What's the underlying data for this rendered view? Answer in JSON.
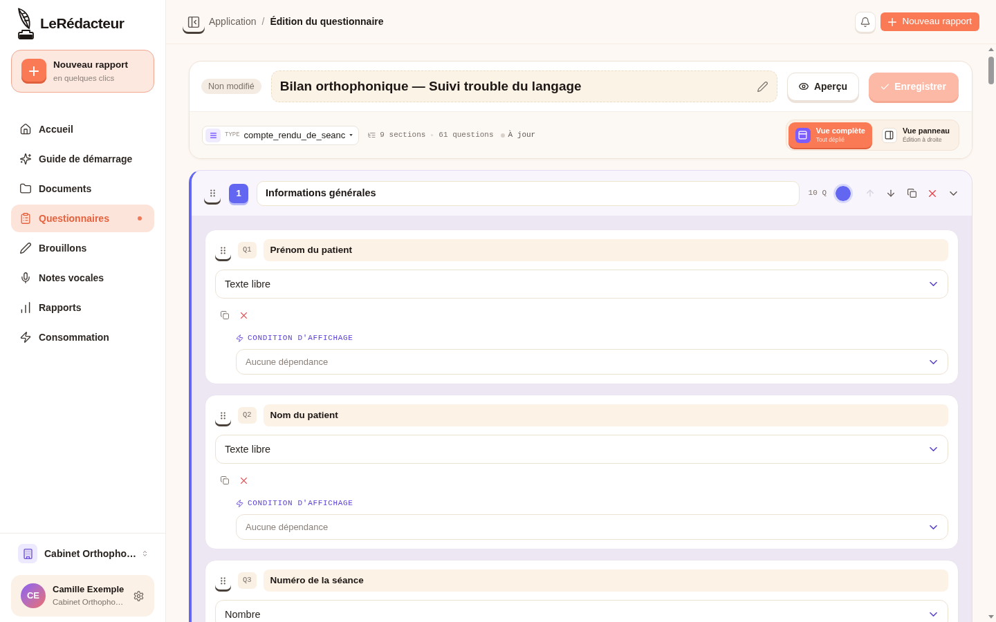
{
  "sidebar": {
    "brand": "LeRédacteur",
    "new_report": {
      "title": "Nouveau rapport",
      "subtitle": "en quelques clics"
    },
    "nav": [
      {
        "label": "Accueil",
        "selected": false
      },
      {
        "label": "Guide de démarrage",
        "selected": false
      },
      {
        "label": "Documents",
        "selected": false
      },
      {
        "label": "Questionnaires",
        "selected": true
      },
      {
        "label": "Brouillons",
        "selected": false
      },
      {
        "label": "Notes vocales",
        "selected": false
      },
      {
        "label": "Rapports",
        "selected": false
      },
      {
        "label": "Consommation",
        "selected": false
      }
    ],
    "workspace": {
      "name": "Cabinet Orthopho…"
    },
    "user": {
      "initials": "CE",
      "name": "Camille Exemple",
      "organization": "Cabinet Orthopho…"
    }
  },
  "header": {
    "breadcrumb": [
      "Application",
      "Édition du questionnaire"
    ],
    "separator": "/",
    "new_report_button": "Nouveau rapport"
  },
  "editor": {
    "status": "Non modifié",
    "title": "Bilan orthophonique — Suivi trouble du langage",
    "preview_button": "Aperçu",
    "save_button": {
      "label": "Enregistrer",
      "disabled": true
    },
    "type": {
      "label": "TYPE",
      "value": "compte_rendu_de_seanc"
    },
    "stats": [
      "9 sections",
      "61 questions"
    ],
    "sync_status": "À jour",
    "views": [
      {
        "title": "Vue complète",
        "subtitle": "Tout déplié",
        "selected": true
      },
      {
        "title": "Vue panneau",
        "subtitle": "Édition à droite",
        "selected": false
      }
    ]
  },
  "sections": [
    {
      "number": "1",
      "title": "Informations générales",
      "count": "10 Q",
      "color": "#6366f1",
      "actions": [
        {
          "kind": "move_up",
          "disabled": true
        },
        {
          "kind": "move_down",
          "disabled": false
        },
        {
          "kind": "duplicate",
          "disabled": false
        },
        {
          "kind": "delete",
          "disabled": false
        },
        {
          "kind": "collapse",
          "disabled": false
        }
      ],
      "questions": [
        {
          "number": "Q1",
          "title": "Prénom du patient",
          "type": "Texte libre",
          "condition_label": "CONDITION D'AFFICHAGE",
          "condition": "Aucune dépendance"
        },
        {
          "number": "Q2",
          "title": "Nom du patient",
          "type": "Texte libre",
          "condition_label": "CONDITION D'AFFICHAGE",
          "condition": "Aucune dépendance"
        },
        {
          "number": "Q3",
          "title": "Numéro de la séance",
          "type": "Nombre"
        }
      ]
    }
  ]
}
